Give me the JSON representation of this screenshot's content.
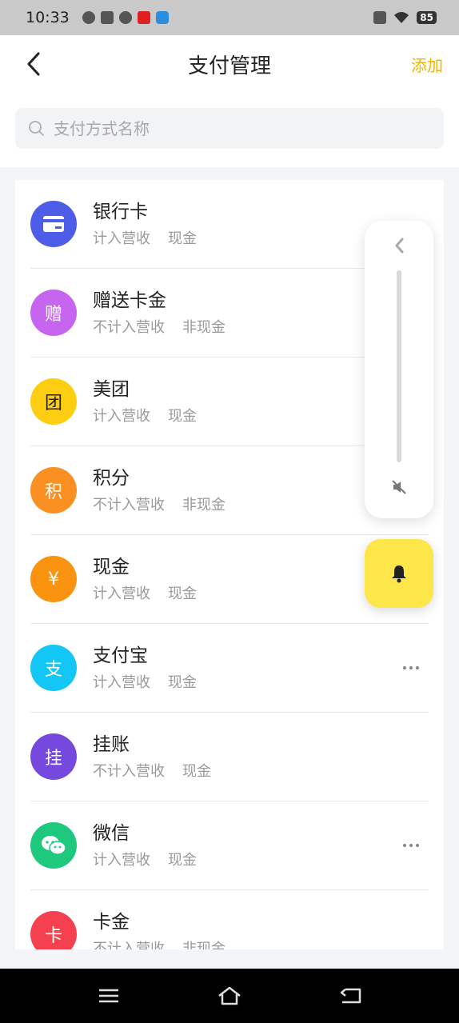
{
  "status_bar": {
    "time": "10:33",
    "battery": "85",
    "icons": [
      "wechat-icon",
      "calendar-icon",
      "compass-icon",
      "ting-app-icon",
      "qq-browser-icon",
      "sim-off-icon",
      "wifi-icon"
    ]
  },
  "header": {
    "title": "支付管理",
    "add_label": "添加"
  },
  "search": {
    "placeholder": "支付方式名称"
  },
  "payments": [
    {
      "name": "银行卡",
      "revenue": "计入营收",
      "cash": "现金",
      "icon": "bank-card-icon",
      "glyph": "",
      "color": "#4e5de8",
      "has_more": true
    },
    {
      "name": "赠送卡金",
      "revenue": "不计入营收",
      "cash": "非现金",
      "icon": "gift-icon",
      "glyph": "赠",
      "color": "#c665f0",
      "has_more": false
    },
    {
      "name": "美团",
      "revenue": "计入营收",
      "cash": "现金",
      "icon": "meituan-icon",
      "glyph": "团",
      "color": "#fccd10",
      "has_more": false
    },
    {
      "name": "积分",
      "revenue": "不计入营收",
      "cash": "非现金",
      "icon": "points-icon",
      "glyph": "积",
      "color": "#fa8f22",
      "has_more": false
    },
    {
      "name": "现金",
      "revenue": "计入营收",
      "cash": "现金",
      "icon": "yuan-icon",
      "glyph": "¥",
      "color": "#fa9310",
      "has_more": false
    },
    {
      "name": "支付宝",
      "revenue": "计入营收",
      "cash": "现金",
      "icon": "alipay-icon",
      "glyph": "支",
      "color": "#12c6f6",
      "has_more": true
    },
    {
      "name": "挂账",
      "revenue": "不计入营收",
      "cash": "现金",
      "icon": "credit-icon",
      "glyph": "挂",
      "color": "#7549dd",
      "has_more": false
    },
    {
      "name": "微信",
      "revenue": "计入营收",
      "cash": "现金",
      "icon": "wechat-icon",
      "glyph": "",
      "color": "#1ec87c",
      "has_more": true
    },
    {
      "name": "卡金",
      "revenue": "不计入营收",
      "cash": "非现金",
      "icon": "card-icon",
      "glyph": "卡",
      "color": "#f54050",
      "has_more": false
    }
  ],
  "colors": {
    "accent": "#f0b400",
    "bell_button": "#fce64a"
  }
}
